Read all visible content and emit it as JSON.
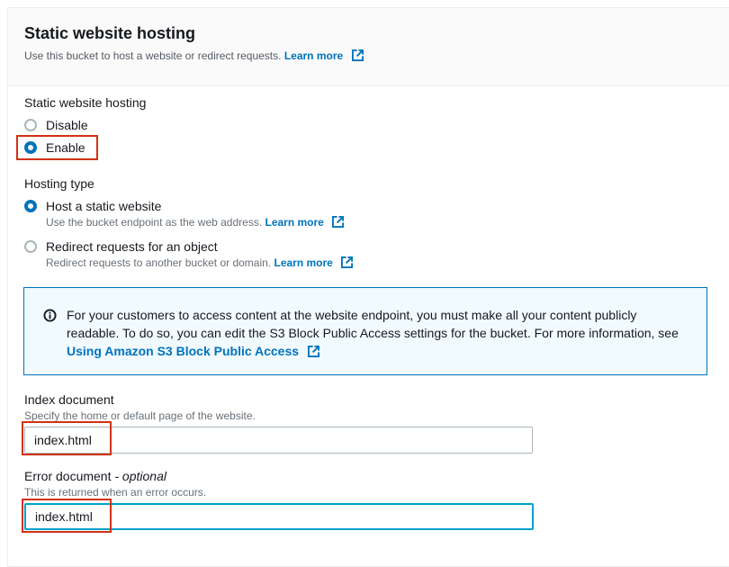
{
  "section": {
    "title": "Static website hosting",
    "description": "Use this bucket to host a website or redirect requests.",
    "learn_more": "Learn more"
  },
  "hosting": {
    "label": "Static website hosting",
    "options": [
      "Disable",
      "Enable"
    ],
    "selected": "Enable"
  },
  "hosting_type": {
    "label": "Hosting type",
    "selected": "Host a static website",
    "options": [
      {
        "label": "Host a static website",
        "description": "Use the bucket endpoint as the web address.",
        "learn_more": "Learn more"
      },
      {
        "label": "Redirect requests for an object",
        "description": "Redirect requests to another bucket or domain.",
        "learn_more": "Learn more"
      }
    ]
  },
  "info_alert": {
    "line1": "For your customers to access content at the website endpoint, you must make all your content publicly",
    "line2": "readable. To do so, you can edit the S3 Block Public Access settings for the bucket. For more information, see",
    "link": "Using Amazon S3 Block Public Access"
  },
  "index_document": {
    "label": "Index document",
    "description": "Specify the home or default page of the website.",
    "value": "index.html"
  },
  "error_document": {
    "label": "Error document",
    "optional": "- optional",
    "description": "This is returned when an error occurs.",
    "value": "index.html"
  },
  "colors": {
    "link": "#0073bb",
    "highlight_box": "#d13212",
    "alert_background": "#f1faff",
    "focus_border": "#00a1c9"
  }
}
